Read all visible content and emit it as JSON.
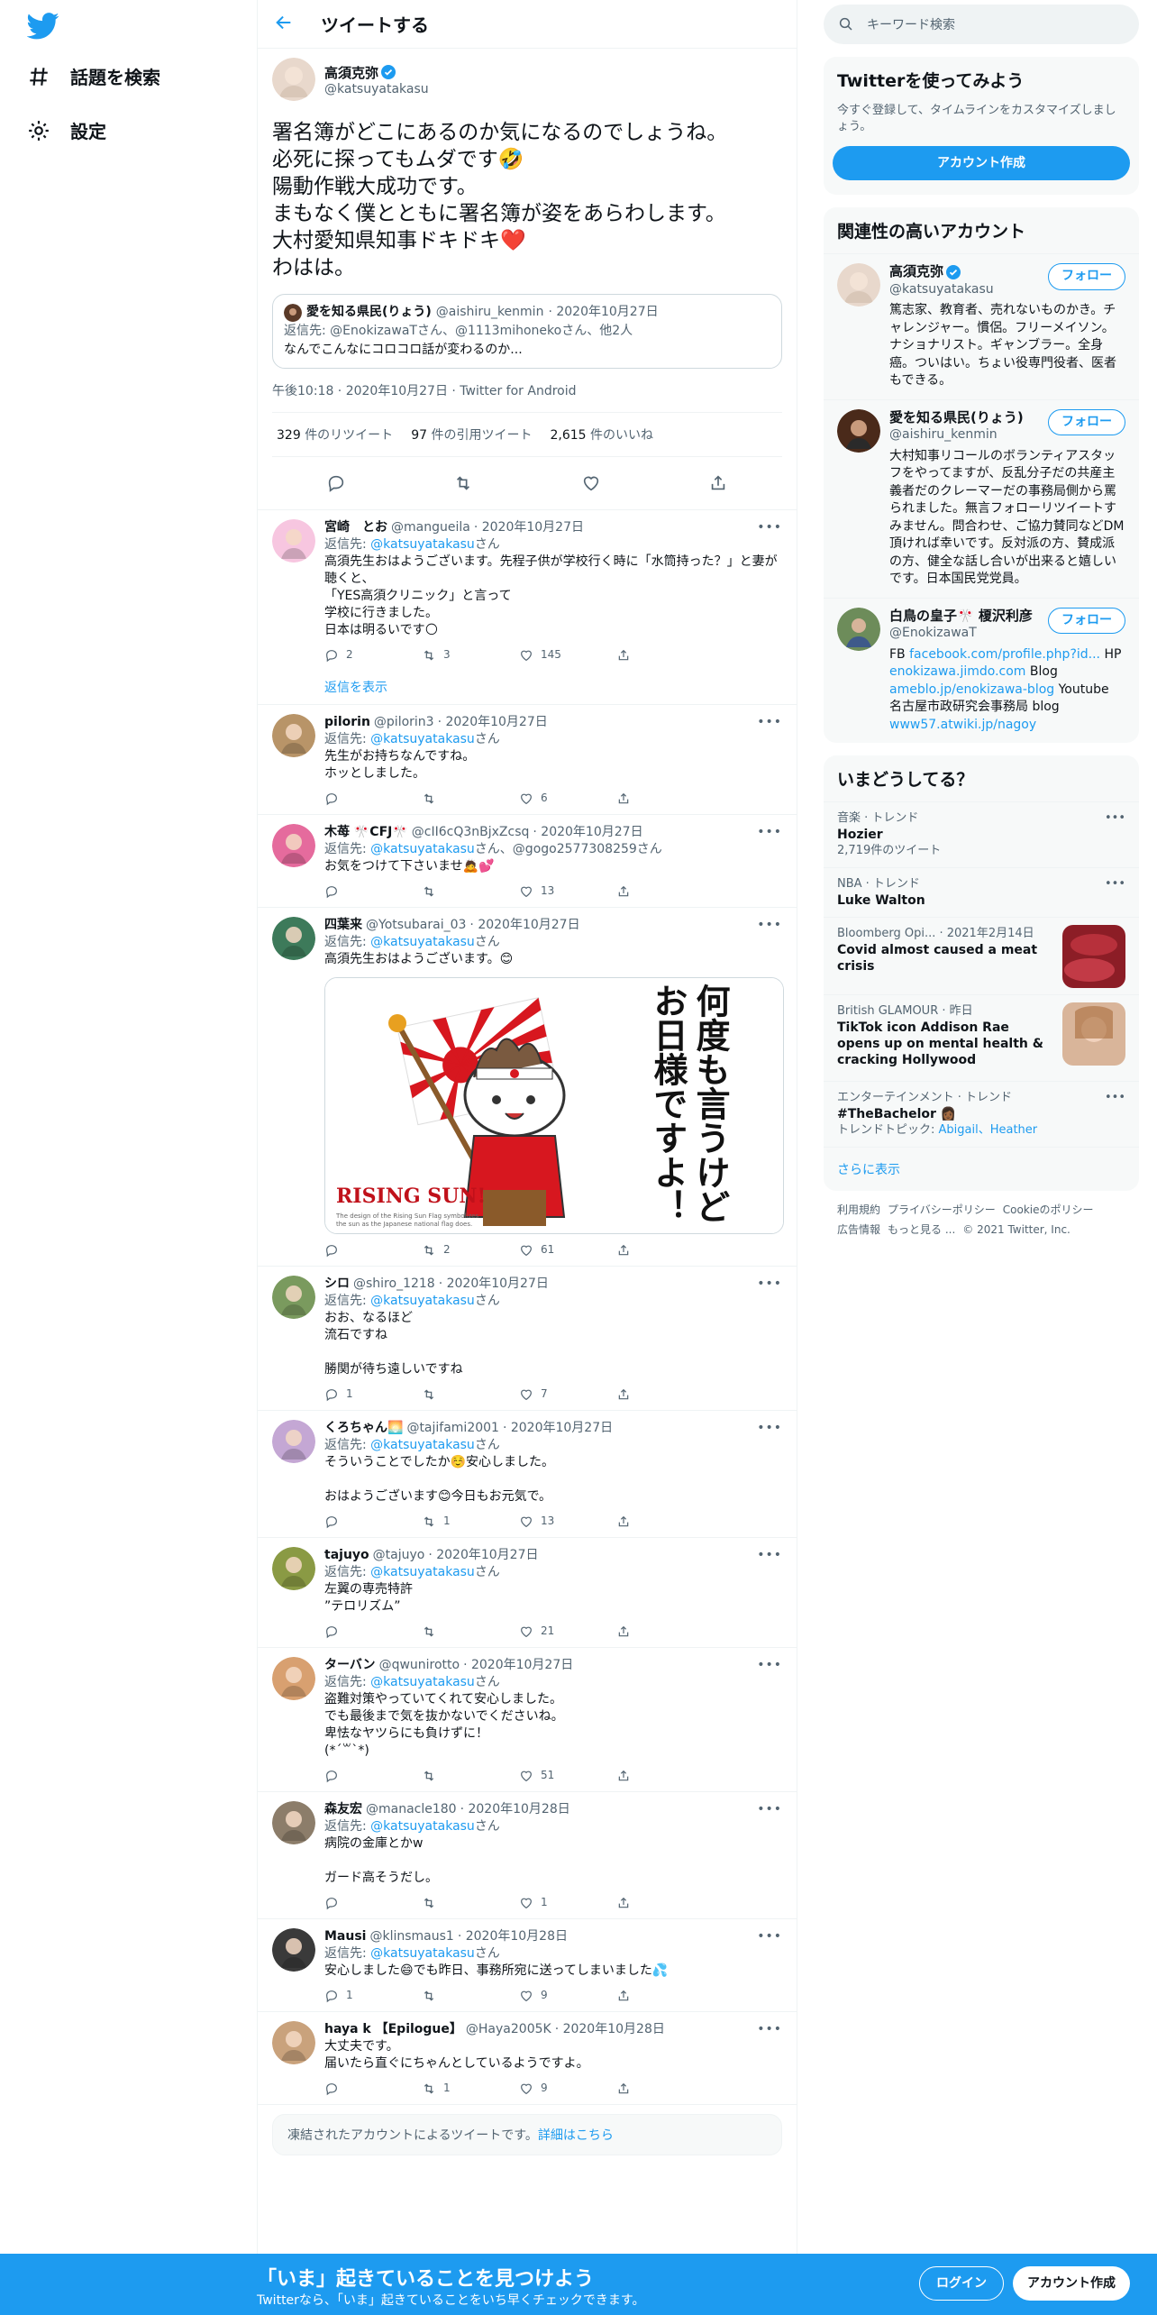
{
  "nav": {
    "explore": "話題を検索",
    "settings": "設定"
  },
  "header": {
    "title": "ツイートする"
  },
  "focal": {
    "name": "高須克弥",
    "handle": "@katsuyatakasu",
    "text": "署名簿がどこにあるのか気になるのでしょうね。\n必死に探ってもムダです🤣\n陽動作戦大成功です。\nまもなく僕とともに署名簿が姿をあらわします。\n大村愛知県知事ドキドキ❤️\nわはは。",
    "quote": {
      "name": "愛を知る県民(りょう)",
      "handle": "@aishiru_kenmin",
      "date": "· 2020年10月27日",
      "replyto": "返信先: @EnokizawaTさん、@1113mihonekoさん、他2人",
      "text": "なんでこんなにコロコロ話が変わるのか..."
    },
    "meta": "午後10:18 · 2020年10月27日 · Twitter for Android",
    "retweets": "329",
    "retweets_label": "件のリツイート",
    "quotes": "97",
    "quotes_label": "件の引用ツイート",
    "likes": "2,615",
    "likes_label": "件のいいね"
  },
  "replies": [
    {
      "name": "宮崎　とお",
      "handle": "@mangueila",
      "date": "· 2020年10月27日",
      "reply_prefix": "返信先: ",
      "reply_to": "@katsuyatakasu",
      "reply_suffix": "さん",
      "text": "高須先生おはようございます。先程子供が学校行く時に「水筒持った？」と妻が聴くと、\n「YES高須クリニック」と言って\n学校に行きました。\n日本は明るいです🌕",
      "reply_count": "2",
      "rt_count": "3",
      "like_count": "145",
      "show_replies": "返信を表示"
    },
    {
      "name": "pilorin",
      "handle": "@pilorin3",
      "date": "· 2020年10月27日",
      "reply_prefix": "返信先: ",
      "reply_to": "@katsuyatakasu",
      "reply_suffix": "さん",
      "text": "先生がお持ちなんですね。\nホッとしました。",
      "reply_count": "",
      "rt_count": "",
      "like_count": "6"
    },
    {
      "name": "木苺 🎌CFJ🎌",
      "handle": "@cII6cQ3nBjxZcsq",
      "date": "· 2020年10月27日",
      "reply_prefix": "返信先: ",
      "reply_to": "@katsuyatakasu",
      "reply_suffix": "さん、@gogo2577308259さん",
      "text": "お気をつけて下さいませ🙇💕",
      "reply_count": "",
      "rt_count": "",
      "like_count": "13"
    },
    {
      "name": "四葉来",
      "handle": "@Yotsubarai_03",
      "date": "· 2020年10月27日",
      "reply_prefix": "返信先: ",
      "reply_to": "@katsuyatakasu",
      "reply_suffix": "さん",
      "text": "高須先生おはようございます。😊",
      "reply_count": "",
      "rt_count": "2",
      "like_count": "61",
      "media": {
        "vertical_text": "何度も言うけど",
        "vertical_text2": "お日様ですよ！",
        "brand": "RISING SUN!",
        "caption": "The design of the Rising Sun Flag symbolizes the sun as the Japanese national flag does."
      }
    },
    {
      "name": "シロ",
      "handle": "@shiro_1218",
      "date": "· 2020年10月27日",
      "reply_prefix": "返信先: ",
      "reply_to": "@katsuyatakasu",
      "reply_suffix": "さん",
      "text": "おお、なるほど\n流石ですね\n\n勝関が待ち遠しいですね",
      "reply_count": "1",
      "rt_count": "",
      "like_count": "7"
    },
    {
      "name": "くろちゃん🌅",
      "handle": "@tajifami2001",
      "date": "· 2020年10月27日",
      "reply_prefix": "返信先: ",
      "reply_to": "@katsuyatakasu",
      "reply_suffix": "さん",
      "text": "そういうことでしたか☺️安心しました。\n\nおはようございます😊今日もお元気で。",
      "reply_count": "",
      "rt_count": "1",
      "like_count": "13"
    },
    {
      "name": "tajuyo",
      "handle": "@tajuyo",
      "date": "· 2020年10月27日",
      "reply_prefix": "返信先: ",
      "reply_to": "@katsuyatakasu",
      "reply_suffix": "さん",
      "text": "左翼の専売特許\n”テロリズム”",
      "reply_count": "",
      "rt_count": "",
      "like_count": "21"
    },
    {
      "name": "ターバン",
      "handle": "@qwunirotto",
      "date": "· 2020年10月27日",
      "reply_prefix": "返信先: ",
      "reply_to": "@katsuyatakasu",
      "reply_suffix": "さん",
      "text": "盗難対策やっていてくれて安心しました。\nでも最後まで気を抜かないでくださいね。\n卑怯なヤツらにも負けずに！\n(*´꒳`*)",
      "reply_count": "",
      "rt_count": "",
      "like_count": "51"
    },
    {
      "name": "森友宏",
      "handle": "@manacle180",
      "date": "· 2020年10月28日",
      "reply_prefix": "返信先: ",
      "reply_to": "@katsuyatakasu",
      "reply_suffix": "さん",
      "text": "病院の金庫とかw\n\nガード高そうだし。",
      "reply_count": "",
      "rt_count": "",
      "like_count": "1"
    },
    {
      "name": "Mausi",
      "handle": "@klinsmaus1",
      "date": "· 2020年10月28日",
      "reply_prefix": "返信先: ",
      "reply_to": "@katsuyatakasu",
      "reply_suffix": "さん",
      "text": "安心しました😄でも昨日、事務所宛に送ってしまいました💦",
      "reply_count": "1",
      "rt_count": "",
      "like_count": "9"
    },
    {
      "name": "haya k 【Epilogue】",
      "handle": "@Haya2005K",
      "date": "· 2020年10月28日",
      "reply_prefix": "",
      "reply_to": "",
      "reply_suffix": "",
      "text": "大丈夫です。\n届いたら直ぐにちゃんとしているようですよ。",
      "reply_count": "",
      "rt_count": "1",
      "like_count": "9"
    }
  ],
  "notice": {
    "text": "凍結されたアカウントによるツイートです。",
    "link": "詳細はこちら"
  },
  "right": {
    "search_placeholder": "キーワード検索",
    "signup": {
      "title": "Twitterを使ってみよう",
      "sub": "今すぐ登録して、タイムラインをカスタマイズしましょう。",
      "button": "アカウント作成"
    },
    "relevant": {
      "title": "関連性の高いアカウント",
      "follow": "フォロー",
      "accounts": [
        {
          "name": "高須克弥",
          "handle": "@katsuyatakasu",
          "bio": "篤志家、教育者、売れないものかき。チャレンジャー。慣侶。フリーメイソン。ナショナリスト。ギャンブラー。全身癌。ついはい。ちょい役専門役者、医者もできる。"
        },
        {
          "name": "愛を知る県民(りょう)",
          "handle": "@aishiru_kenmin",
          "bio": "大村知事リコールのボランティアスタッフをやってますが、反乱分子だの共産主義者だのクレーマーだの事務局側から罵られました。無言フォローリツイートすみません。問合わせ、ご協力賛同などDM頂ければ幸いです。反対派の方、賛成派の方、健全な話し合いが出来ると嬉しいです。日本国民党党員。"
        },
        {
          "name": "白鳥の皇子🎌 榎沢利彦",
          "handle": "@EnokizawaT",
          "bio_a": "FB ",
          "bio_link1": "facebook.com/profile.php?id...",
          "bio_b": " HP ",
          "bio_link2": "enokizawa.jimdo.com",
          "bio_c": " Blog ",
          "bio_link3": "ameblo.jp/enokizawa-blog",
          "bio_d": " Youtube 名古屋市政研究会事務局 blog ",
          "bio_link4": "www57.atwiki.jp/nagoy"
        }
      ]
    },
    "trends": {
      "title": "いまどうしてる？",
      "items": [
        {
          "cat": "音楽 · トレンド",
          "title": "Hozier",
          "sub": "2,719件のツイート"
        },
        {
          "cat": "NBA · トレンド",
          "title": "Luke Walton",
          "sub": ""
        },
        {
          "cat": "Bloomberg Opi... · 2021年2月14日",
          "title": "Covid almost caused a meat crisis",
          "sub": ""
        },
        {
          "cat": "British GLAMOUR · 昨日",
          "title": "TikTok icon Addison Rae opens up on mental health & cracking Hollywood",
          "sub": ""
        },
        {
          "cat": "エンターテインメント · トレンド",
          "title": "#TheBachelor 👩🏾",
          "sub_prefix": "トレンドトピック: ",
          "sub_link": "Abigail、Heather"
        }
      ],
      "show_more": "さらに表示"
    },
    "footer": [
      "利用規約",
      "プライバシーポリシー",
      "Cookieのポリシー",
      "広告情報",
      "もっと見る ...",
      "© 2021 Twitter, Inc."
    ]
  },
  "bottom": {
    "title": "「いま」起きていることを見つけよう",
    "sub": "Twitterなら、「いま」起きていることをいち早くチェックできます。",
    "login": "ログイン",
    "signup": "アカウント作成"
  },
  "colors": {
    "accent": "#1d9bf0",
    "text": "#0f1419",
    "muted": "#536471"
  }
}
